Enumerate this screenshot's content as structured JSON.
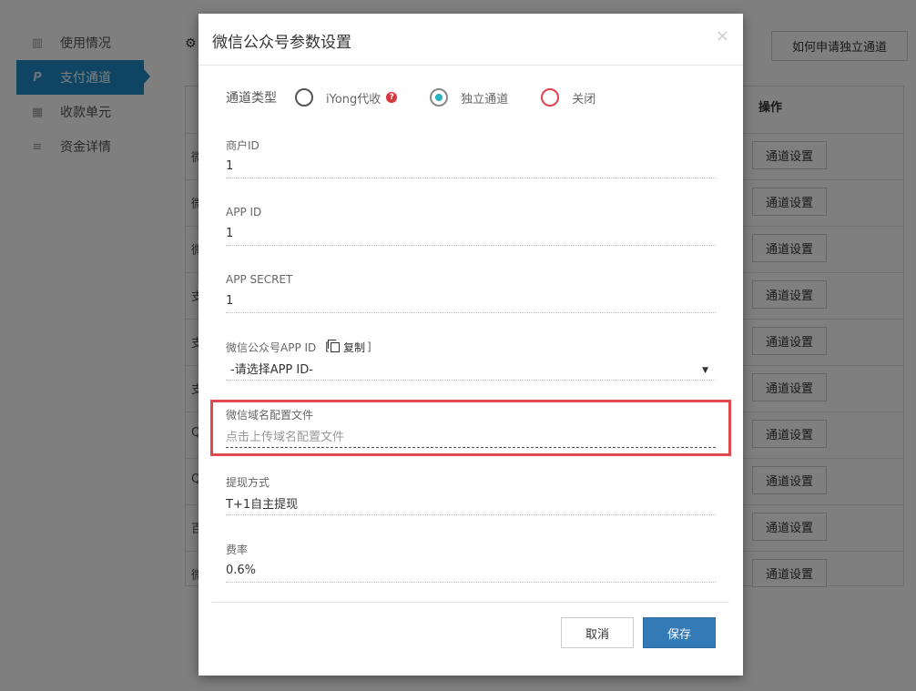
{
  "sidebar": {
    "items": [
      {
        "label": "使用情况",
        "icon": "bar-chart-icon"
      },
      {
        "label": "支付通道",
        "icon": "paypal-icon"
      },
      {
        "label": "收款单元",
        "icon": "grid-icon"
      },
      {
        "label": "资金详情",
        "icon": "list-icon"
      }
    ]
  },
  "background": {
    "help_button": "如何申请独立通道",
    "table_header_op": "操作",
    "row_button": "通道设置",
    "row_stubs": [
      "微",
      "微",
      "微",
      "支",
      "支",
      "支",
      "Q",
      "Q",
      "百",
      "微"
    ]
  },
  "modal": {
    "title": "微信公众号参数设置",
    "close": "×",
    "channel_type": {
      "label": "通道类型",
      "options": [
        {
          "label": "iYong代收",
          "checked": false,
          "help_icon": "question-icon"
        },
        {
          "label": "独立通道",
          "checked": true
        },
        {
          "label": "关闭",
          "checked": false
        }
      ]
    },
    "merchant_id": {
      "label": "商户ID",
      "value": "1"
    },
    "app_id": {
      "label": "APP ID",
      "value": "1"
    },
    "app_secret": {
      "label": "APP SECRET",
      "value": "1"
    },
    "wx_app_id": {
      "label": "微信公众号APP ID",
      "copy_open": "[",
      "copy_label": "复制",
      "copy_close": "]",
      "selected": "-请选择APP ID-"
    },
    "domain_file": {
      "label": "微信域名配置文件",
      "placeholder": "点击上传域名配置文件"
    },
    "withdraw": {
      "label": "提现方式",
      "value": "T+1自主提现"
    },
    "rate": {
      "label": "费率",
      "value": "0.6%"
    },
    "buttons": {
      "cancel": "取消",
      "save": "保存"
    }
  },
  "colors": {
    "primary": "#337ab7",
    "sidebar_active": "#1e88c7",
    "highlight": "#e04a4f",
    "radio_checked": "#26b4c4",
    "radio_close": "#e0434d"
  }
}
